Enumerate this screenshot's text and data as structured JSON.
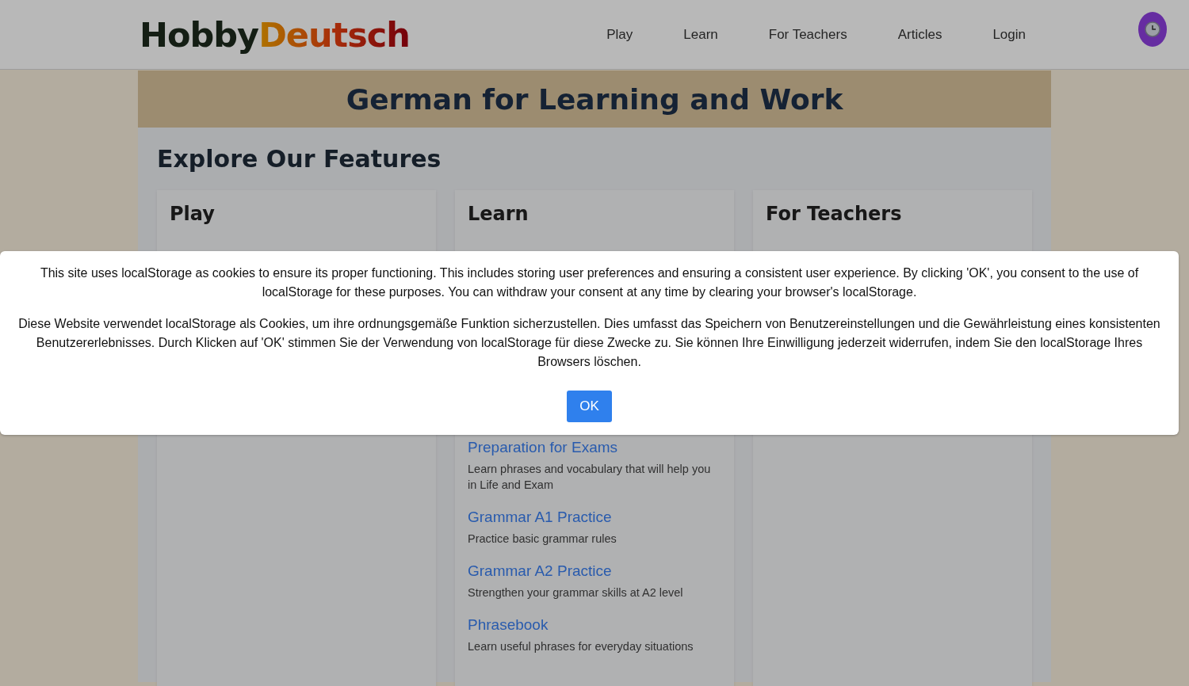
{
  "header": {
    "logo_parts": [
      {
        "text": "Hobby",
        "kind": "plain"
      },
      {
        "text": "Deutsch",
        "kind": "gradient"
      }
    ],
    "nav": [
      {
        "label": "Play"
      },
      {
        "label": "Learn"
      },
      {
        "label": "For Teachers"
      },
      {
        "label": "Articles"
      },
      {
        "label": "Login"
      }
    ]
  },
  "banner": {
    "title": "German for Learning and Work"
  },
  "features": {
    "title": "Explore Our Features",
    "cards": [
      {
        "title": "Play"
      },
      {
        "title": "Learn",
        "items": [
          {
            "title": "Preparation for Exams",
            "description": "Learn phrases and vocabulary that will help you in Life and Exam"
          },
          {
            "title": "Grammar A1 Practice",
            "description": "Practice basic grammar rules"
          },
          {
            "title": "Grammar A2 Practice",
            "description": "Strengthen your grammar skills at A2 level"
          },
          {
            "title": "Phrasebook",
            "description": "Learn useful phrases for everyday situations"
          }
        ]
      },
      {
        "title": "For Teachers"
      }
    ]
  },
  "cookie_dialog": {
    "paragraphs": [
      "This site uses localStorage as cookies to ensure its proper functioning. This includes storing user preferences and ensuring a consistent user experience. By clicking 'OK', you consent to the use of localStorage for these purposes. You can withdraw your consent at any time by clearing your browser's localStorage.",
      "Diese Website verwendet localStorage als Cookies, um ihre ordnungsgemäße Funktion sicherzustellen. Dies umfasst das Speichern von Benutzereinstellungen und die Gewährleistung eines konsistenten Benutzererlebnisses. Durch Klicken auf 'OK' stimmen Sie der Verwendung von localStorage für diese Zwecke zu. Sie können Ihre Einwilligung jederzeit widerrufen, indem Sie den localStorage Ihres Browsers löschen."
    ],
    "button": "OK"
  }
}
